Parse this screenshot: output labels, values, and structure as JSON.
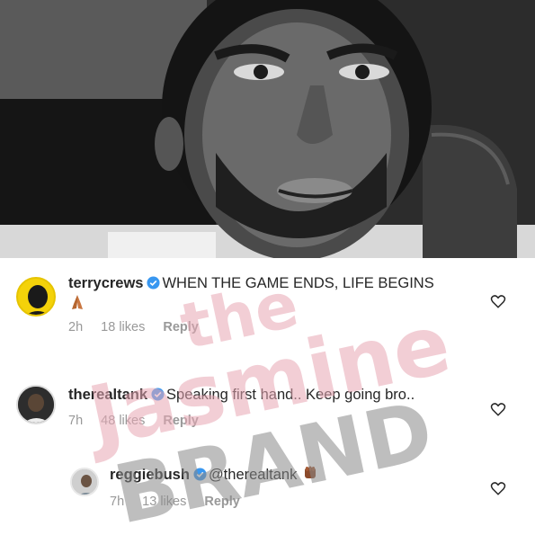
{
  "photo": {
    "description_icon": "video-still-icon"
  },
  "comments": [
    {
      "username": "terrycrews",
      "text": "WHEN THE GAME ENDS, LIFE BEGINS",
      "emoji": "folded-hands-icon",
      "time": "2h",
      "likes": "18 likes",
      "reply": "Reply",
      "avatar_color": "#f4d20a"
    },
    {
      "username": "therealtank",
      "text": "Speaking first hand.. Keep going bro..",
      "time": "7h",
      "likes": "48 likes",
      "reply": "Reply",
      "avatar_color": "#2a2a2a"
    },
    {
      "username": "reggiebush",
      "text": "@therealtank",
      "emoji": "raised-fist-icon",
      "time": "7h",
      "likes": "13 likes",
      "reply": "Reply",
      "avatar_color": "#b9b9b9"
    }
  ],
  "watermark": {
    "line1": "the",
    "line2": "Jasmine",
    "line3": "BRAND"
  },
  "colors": {
    "verified": "#3897f0",
    "meta_text": "#999999",
    "watermark_pink": "#e8a7b4",
    "watermark_gray": "#8a8a8a"
  }
}
